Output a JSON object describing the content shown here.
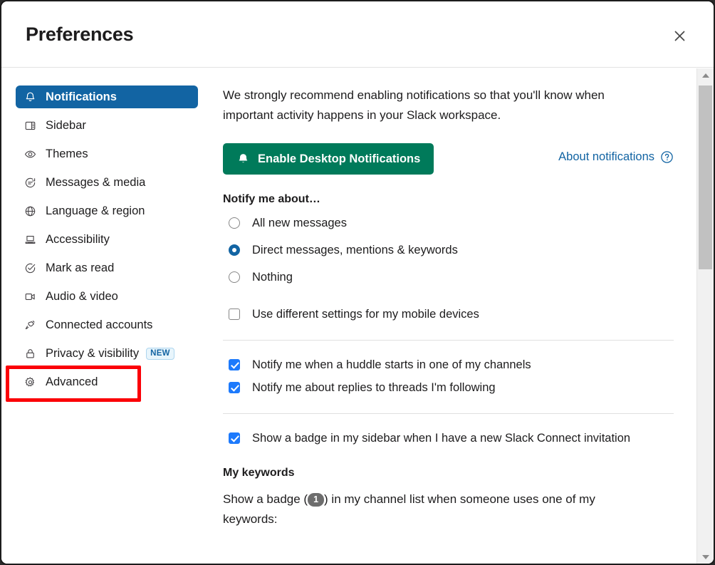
{
  "window": {
    "title": "Preferences",
    "close_icon": "close-icon"
  },
  "colors": {
    "accent_blue": "#1264a3",
    "checkbox_blue": "#1d7afc",
    "button_green": "#007a5a",
    "highlight_red": "#fb0007",
    "badge_grey": "#6d6d6d"
  },
  "sidebar": {
    "items": [
      {
        "label": "Notifications",
        "icon": "bell-icon",
        "selected": true
      },
      {
        "label": "Sidebar",
        "icon": "sidebar-layout-icon",
        "selected": false
      },
      {
        "label": "Themes",
        "icon": "eye-icon",
        "selected": false
      },
      {
        "label": "Messages & media",
        "icon": "chat-bubble-icon",
        "selected": false
      },
      {
        "label": "Language & region",
        "icon": "globe-icon",
        "selected": false
      },
      {
        "label": "Accessibility",
        "icon": "keyboard-icon",
        "selected": false
      },
      {
        "label": "Mark as read",
        "icon": "check-circle-icon",
        "selected": false
      },
      {
        "label": "Audio & video",
        "icon": "video-camera-icon",
        "selected": false
      },
      {
        "label": "Connected accounts",
        "icon": "plug-icon",
        "selected": false
      },
      {
        "label": "Privacy & visibility",
        "icon": "lock-icon",
        "selected": false,
        "badge": "NEW"
      },
      {
        "label": "Advanced",
        "icon": "gear-icon",
        "selected": false,
        "highlighted": true
      }
    ]
  },
  "content": {
    "intro": "We strongly recommend enabling notifications so that you'll know when important activity happens in your Slack workspace.",
    "enable_button": "Enable Desktop Notifications",
    "enable_button_icon": "bell-icon",
    "about_link": "About notifications",
    "about_link_icon": "question-circle-icon",
    "notify_heading": "Notify me about…",
    "radio_options": [
      {
        "label": "All new messages",
        "checked": false
      },
      {
        "label": "Direct messages, mentions & keywords",
        "checked": true
      },
      {
        "label": "Nothing",
        "checked": false
      }
    ],
    "mobile_checkbox": {
      "label": "Use different settings for my mobile devices",
      "checked": false
    },
    "group_checkboxes": [
      {
        "label": "Notify me when a huddle starts in one of my channels",
        "checked": true
      },
      {
        "label": "Notify me about replies to threads I'm following",
        "checked": true
      }
    ],
    "connect_checkbox": {
      "label": "Show a badge in my sidebar when I have a new Slack Connect invitation",
      "checked": true
    },
    "keywords_heading": "My keywords",
    "keywords_text_before": "Show a badge (",
    "keywords_badge_count": "1",
    "keywords_text_after": ") in my channel list when someone uses one of my keywords:"
  },
  "scrollbar": {
    "up_icon": "chevron-up-icon",
    "down_icon": "chevron-down-icon"
  }
}
